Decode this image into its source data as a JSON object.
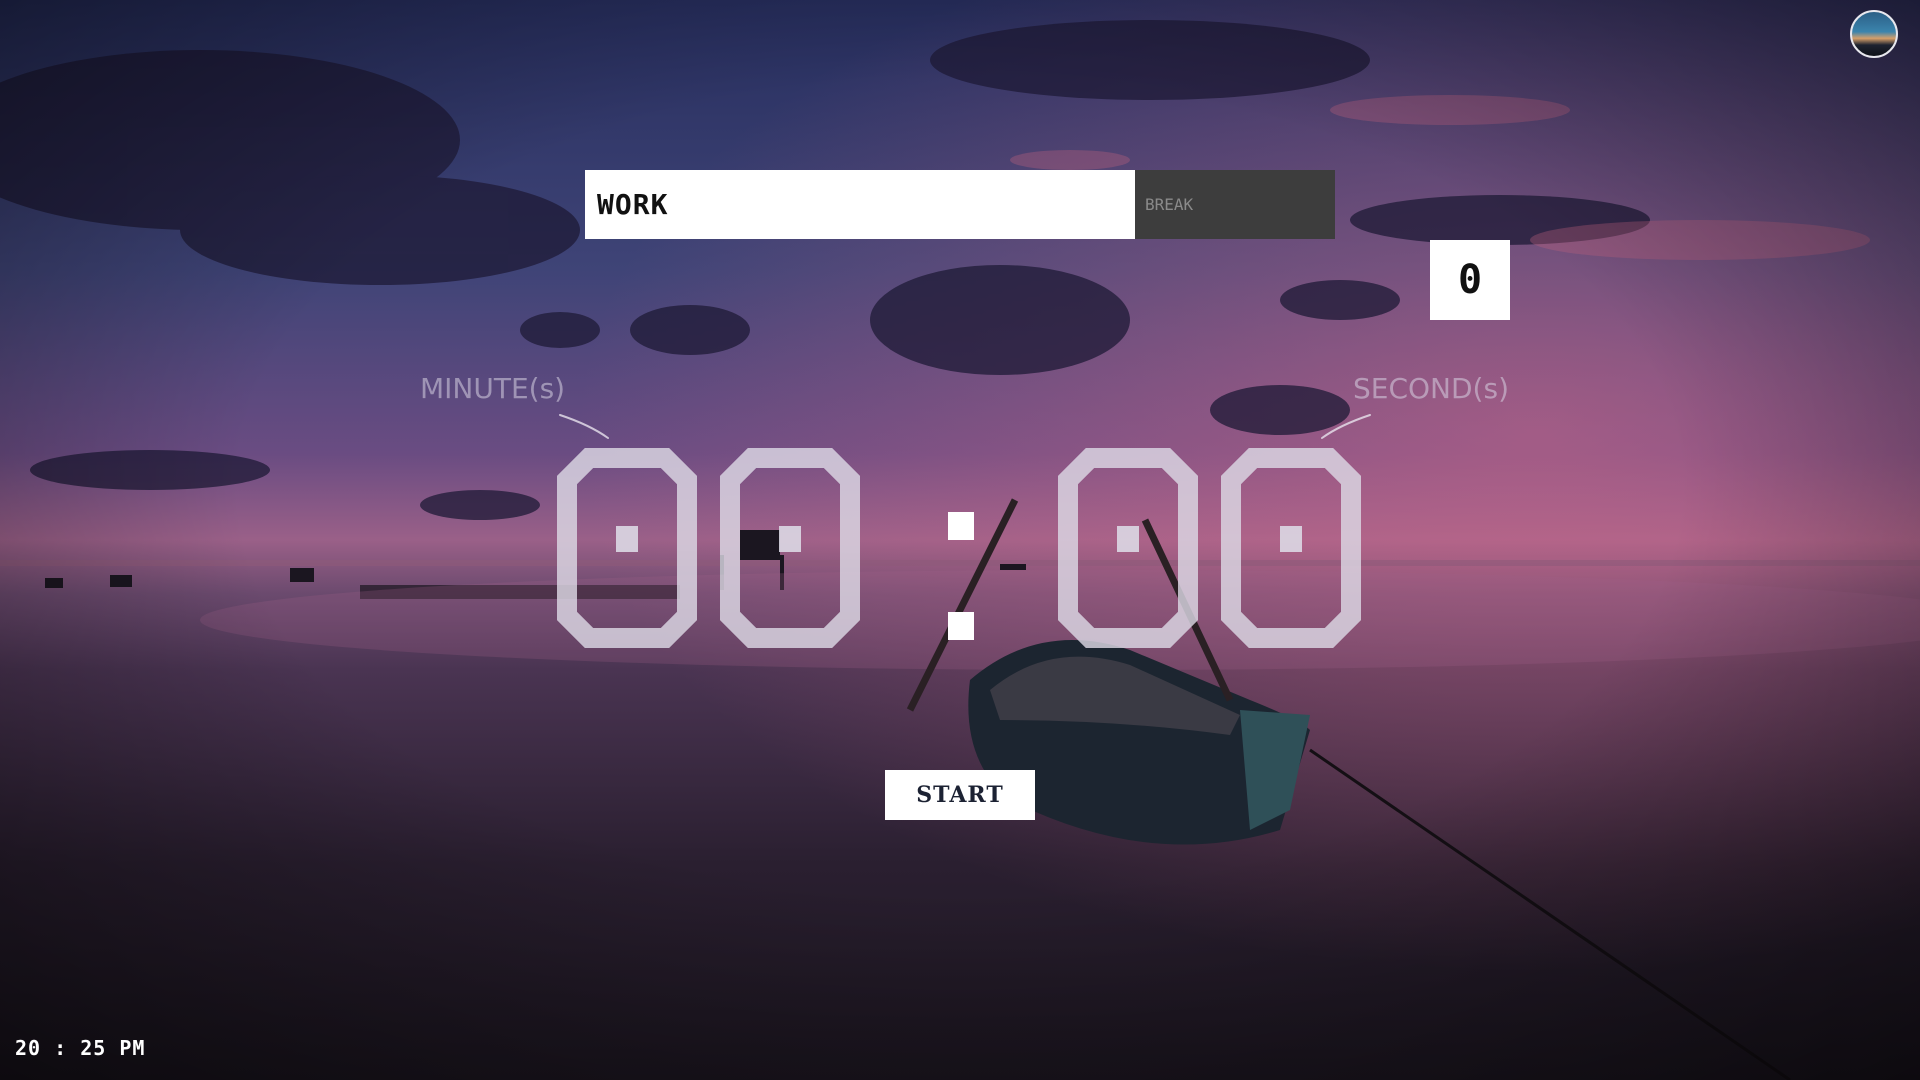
{
  "mode": {
    "work_label": "WORK",
    "break_label": "BREAK",
    "active": "work"
  },
  "session_count": "0",
  "timer": {
    "minutes_label": "MINUTE(s)",
    "seconds_label": "SECOND(s)",
    "minutes": "00",
    "seconds": "00",
    "separator": ":",
    "digit_color": "#dcd8e4"
  },
  "start_label": "START",
  "clock": "20 : 25 PM",
  "avatar": {
    "icon": "landscape-avatar-icon"
  },
  "colors": {
    "sky_top": "#2c3566",
    "sky_mid": "#6a4a80",
    "horizon": "#b06a8a",
    "water": "#2a1f33",
    "break_tab": "#3d3d3d"
  }
}
